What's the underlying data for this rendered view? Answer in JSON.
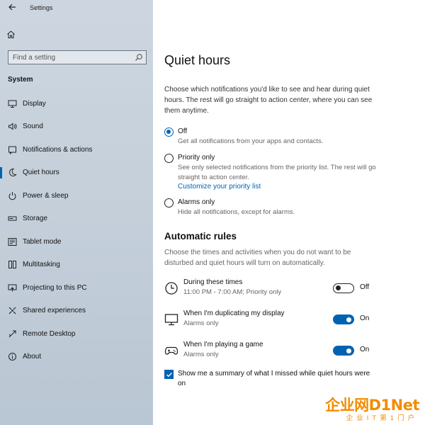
{
  "window": {
    "app_title": "Settings"
  },
  "sidebar": {
    "search_placeholder": "Find a setting",
    "section": "System",
    "items": [
      {
        "label": "Display",
        "icon": "monitor-icon",
        "selected": false
      },
      {
        "label": "Sound",
        "icon": "speaker-icon",
        "selected": false
      },
      {
        "label": "Notifications & actions",
        "icon": "notifications-icon",
        "selected": false
      },
      {
        "label": "Quiet hours",
        "icon": "moon-icon",
        "selected": true
      },
      {
        "label": "Power & sleep",
        "icon": "power-icon",
        "selected": false
      },
      {
        "label": "Storage",
        "icon": "storage-icon",
        "selected": false
      },
      {
        "label": "Tablet mode",
        "icon": "tablet-icon",
        "selected": false
      },
      {
        "label": "Multitasking",
        "icon": "multitasking-icon",
        "selected": false
      },
      {
        "label": "Projecting to this PC",
        "icon": "projecting-icon",
        "selected": false
      },
      {
        "label": "Shared experiences",
        "icon": "shared-experiences-icon",
        "selected": false
      },
      {
        "label": "Remote Desktop",
        "icon": "remote-desktop-icon",
        "selected": false
      },
      {
        "label": "About",
        "icon": "info-icon",
        "selected": false
      }
    ]
  },
  "main": {
    "title": "Quiet hours",
    "description": "Choose which notifications you'd like to see and hear during quiet hours. The rest will go straight to action center, where you can see them anytime.",
    "options": [
      {
        "label": "Off",
        "description": "Get all notifications from your apps and contacts.",
        "checked": true
      },
      {
        "label": "Priority only",
        "description": "See only selected notifications from the priority list. The rest will go straight to action center.",
        "link": "Customize your priority list",
        "checked": false
      },
      {
        "label": "Alarms only",
        "description": "Hide all notifications, except for alarms.",
        "checked": false
      }
    ],
    "automatic_rules": {
      "title": "Automatic rules",
      "description": "Choose the times and activities when you do not want to be disturbed and quiet hours will turn on automatically.",
      "rules": [
        {
          "title": "During these times",
          "subtitle": "11:00 PM - 7:00 AM; Priority only",
          "state": "Off",
          "on": false,
          "icon": "clock-icon"
        },
        {
          "title": "When I'm duplicating my display",
          "subtitle": "Alarms only",
          "state": "On",
          "on": true,
          "icon": "monitor-icon"
        },
        {
          "title": "When I'm playing a game",
          "subtitle": "Alarms only",
          "state": "On",
          "on": true,
          "icon": "gamepad-icon"
        }
      ]
    },
    "summary_checkbox": {
      "label": "Show me a summary of what I missed while quiet hours were on",
      "checked": true
    }
  },
  "watermark": {
    "brand": "企业网D1Net",
    "tagline": "企业IT第1门户"
  }
}
